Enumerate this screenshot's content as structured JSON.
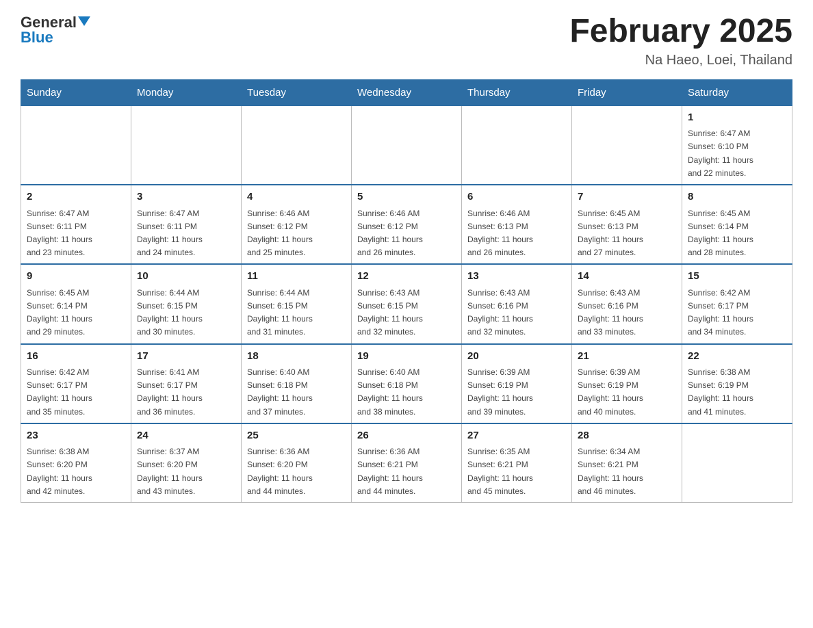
{
  "header": {
    "logo_general": "General",
    "logo_blue": "Blue",
    "title": "February 2025",
    "subtitle": "Na Haeo, Loei, Thailand"
  },
  "weekdays": [
    "Sunday",
    "Monday",
    "Tuesday",
    "Wednesday",
    "Thursday",
    "Friday",
    "Saturday"
  ],
  "weeks": [
    [
      {
        "day": "",
        "info": ""
      },
      {
        "day": "",
        "info": ""
      },
      {
        "day": "",
        "info": ""
      },
      {
        "day": "",
        "info": ""
      },
      {
        "day": "",
        "info": ""
      },
      {
        "day": "",
        "info": ""
      },
      {
        "day": "1",
        "info": "Sunrise: 6:47 AM\nSunset: 6:10 PM\nDaylight: 11 hours\nand 22 minutes."
      }
    ],
    [
      {
        "day": "2",
        "info": "Sunrise: 6:47 AM\nSunset: 6:11 PM\nDaylight: 11 hours\nand 23 minutes."
      },
      {
        "day": "3",
        "info": "Sunrise: 6:47 AM\nSunset: 6:11 PM\nDaylight: 11 hours\nand 24 minutes."
      },
      {
        "day": "4",
        "info": "Sunrise: 6:46 AM\nSunset: 6:12 PM\nDaylight: 11 hours\nand 25 minutes."
      },
      {
        "day": "5",
        "info": "Sunrise: 6:46 AM\nSunset: 6:12 PM\nDaylight: 11 hours\nand 26 minutes."
      },
      {
        "day": "6",
        "info": "Sunrise: 6:46 AM\nSunset: 6:13 PM\nDaylight: 11 hours\nand 26 minutes."
      },
      {
        "day": "7",
        "info": "Sunrise: 6:45 AM\nSunset: 6:13 PM\nDaylight: 11 hours\nand 27 minutes."
      },
      {
        "day": "8",
        "info": "Sunrise: 6:45 AM\nSunset: 6:14 PM\nDaylight: 11 hours\nand 28 minutes."
      }
    ],
    [
      {
        "day": "9",
        "info": "Sunrise: 6:45 AM\nSunset: 6:14 PM\nDaylight: 11 hours\nand 29 minutes."
      },
      {
        "day": "10",
        "info": "Sunrise: 6:44 AM\nSunset: 6:15 PM\nDaylight: 11 hours\nand 30 minutes."
      },
      {
        "day": "11",
        "info": "Sunrise: 6:44 AM\nSunset: 6:15 PM\nDaylight: 11 hours\nand 31 minutes."
      },
      {
        "day": "12",
        "info": "Sunrise: 6:43 AM\nSunset: 6:15 PM\nDaylight: 11 hours\nand 32 minutes."
      },
      {
        "day": "13",
        "info": "Sunrise: 6:43 AM\nSunset: 6:16 PM\nDaylight: 11 hours\nand 32 minutes."
      },
      {
        "day": "14",
        "info": "Sunrise: 6:43 AM\nSunset: 6:16 PM\nDaylight: 11 hours\nand 33 minutes."
      },
      {
        "day": "15",
        "info": "Sunrise: 6:42 AM\nSunset: 6:17 PM\nDaylight: 11 hours\nand 34 minutes."
      }
    ],
    [
      {
        "day": "16",
        "info": "Sunrise: 6:42 AM\nSunset: 6:17 PM\nDaylight: 11 hours\nand 35 minutes."
      },
      {
        "day": "17",
        "info": "Sunrise: 6:41 AM\nSunset: 6:17 PM\nDaylight: 11 hours\nand 36 minutes."
      },
      {
        "day": "18",
        "info": "Sunrise: 6:40 AM\nSunset: 6:18 PM\nDaylight: 11 hours\nand 37 minutes."
      },
      {
        "day": "19",
        "info": "Sunrise: 6:40 AM\nSunset: 6:18 PM\nDaylight: 11 hours\nand 38 minutes."
      },
      {
        "day": "20",
        "info": "Sunrise: 6:39 AM\nSunset: 6:19 PM\nDaylight: 11 hours\nand 39 minutes."
      },
      {
        "day": "21",
        "info": "Sunrise: 6:39 AM\nSunset: 6:19 PM\nDaylight: 11 hours\nand 40 minutes."
      },
      {
        "day": "22",
        "info": "Sunrise: 6:38 AM\nSunset: 6:19 PM\nDaylight: 11 hours\nand 41 minutes."
      }
    ],
    [
      {
        "day": "23",
        "info": "Sunrise: 6:38 AM\nSunset: 6:20 PM\nDaylight: 11 hours\nand 42 minutes."
      },
      {
        "day": "24",
        "info": "Sunrise: 6:37 AM\nSunset: 6:20 PM\nDaylight: 11 hours\nand 43 minutes."
      },
      {
        "day": "25",
        "info": "Sunrise: 6:36 AM\nSunset: 6:20 PM\nDaylight: 11 hours\nand 44 minutes."
      },
      {
        "day": "26",
        "info": "Sunrise: 6:36 AM\nSunset: 6:21 PM\nDaylight: 11 hours\nand 44 minutes."
      },
      {
        "day": "27",
        "info": "Sunrise: 6:35 AM\nSunset: 6:21 PM\nDaylight: 11 hours\nand 45 minutes."
      },
      {
        "day": "28",
        "info": "Sunrise: 6:34 AM\nSunset: 6:21 PM\nDaylight: 11 hours\nand 46 minutes."
      },
      {
        "day": "",
        "info": ""
      }
    ]
  ]
}
